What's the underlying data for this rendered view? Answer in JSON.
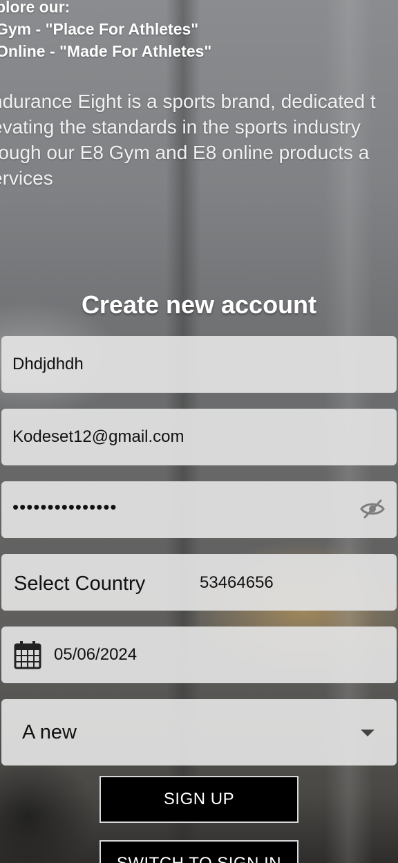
{
  "explore": {
    "heading": "plore our:",
    "line_gym": "Gym - \"Place For Athletes\"",
    "line_online": "Online - \"Made For Athletes\""
  },
  "about": {
    "lines": [
      "ndurance Eight is a sports brand, dedicated t",
      "evating the standards in the sports industry",
      "rough our E8 Gym and E8 online products a",
      "ervices"
    ]
  },
  "form": {
    "title": "Create new account",
    "name_value": "Dhdjdhdh",
    "email_value": "Kodeset12@gmail.com",
    "password_value": "•••••••••••••••",
    "country_label": "Select Country",
    "phone_value": "53464656",
    "date_value": "05/06/2024",
    "role_value": "A new",
    "signup_label": "SIGN UP",
    "switch_label": "SWITCH TO SIGN IN"
  },
  "icons": {
    "password_toggle": "eye-slash-icon",
    "date": "calendar-icon",
    "role_dropdown": "chevron-down-icon"
  },
  "colors": {
    "button_bg": "#000000",
    "button_border": "#d9d9d9",
    "field_bg": "#e2e2e2"
  }
}
